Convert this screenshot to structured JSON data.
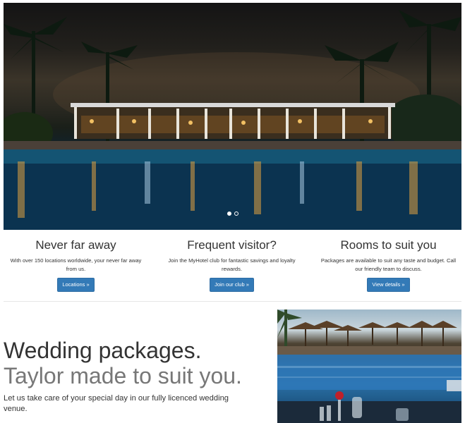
{
  "hero": {
    "slides": [
      {
        "active": true
      },
      {
        "active": false
      }
    ]
  },
  "features": [
    {
      "title": "Never far away",
      "text_line1": "With over 150 locations worldwide, your never far away",
      "text_line2": "from us.",
      "button": "Locations »"
    },
    {
      "title": "Frequent visitor?",
      "text_line1": "Join the MyHotel club for fantastic savings and loyalty",
      "text_line2": "rewards.",
      "button": "Join our club »"
    },
    {
      "title": "Rooms to suit you",
      "text_line1": "Packages are available to suit any taste and budget. Call",
      "text_line2": "our friendly team to discuss.",
      "button": "View details »"
    }
  ],
  "wedding": {
    "heading": "Wedding packages.",
    "subheading": "Taylor made to suit you.",
    "text_line1": "Let us take care of your special day in our fully licenced wedding",
    "text_line2": "venue."
  }
}
